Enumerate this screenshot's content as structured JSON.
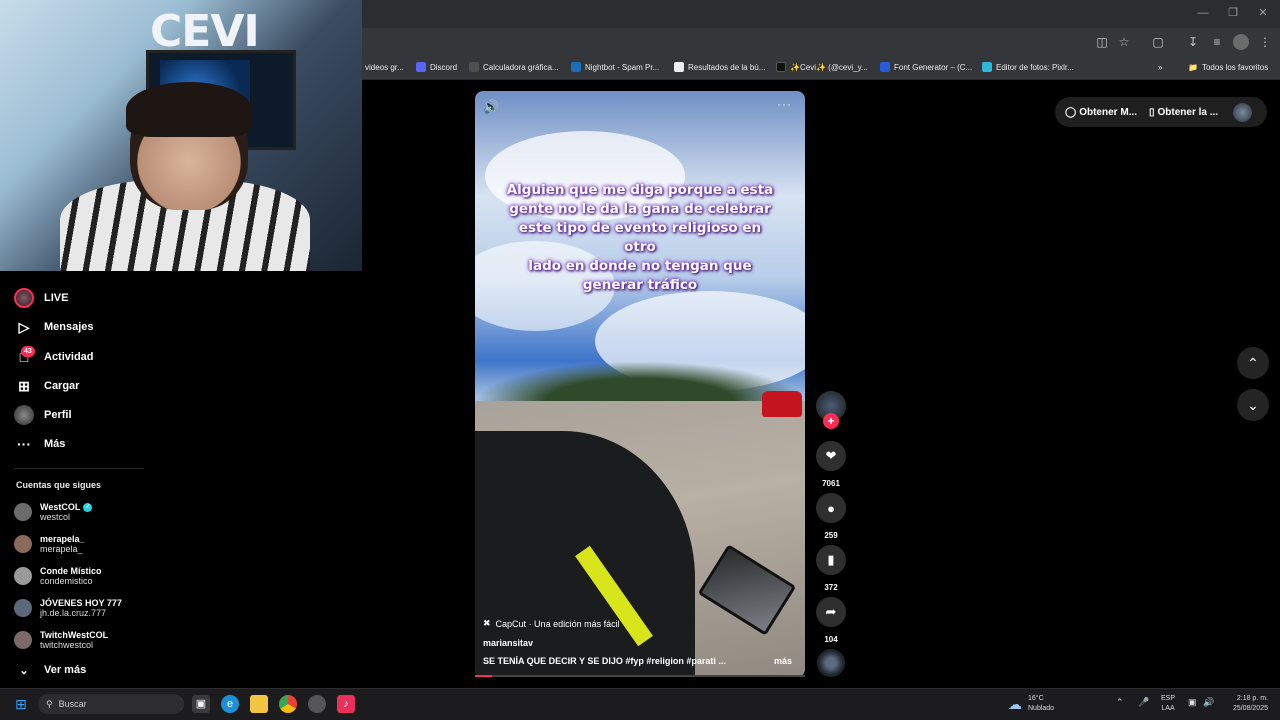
{
  "browser": {
    "bookmarks": [
      {
        "label": "videos gr...",
        "color": "#5f6368"
      },
      {
        "label": "Discord",
        "color": "#5865f2"
      },
      {
        "label": "Calculadora gráfica...",
        "color": "#4f4f4f"
      },
      {
        "label": "Nightbot - Spam Pr...",
        "color": "#1b6fb8"
      },
      {
        "label": "Resultados de la bú...",
        "color": "#eeeeee"
      },
      {
        "label": "✨Cevi✨ (@cevi_y...",
        "color": "#111111"
      },
      {
        "label": "Font Generator – (C...",
        "color": "#2a5bd7"
      },
      {
        "label": "Editor de fotos: Pixlr...",
        "color": "#2fb7d8"
      }
    ],
    "all_bookmarks": "Todos los favoritos"
  },
  "sidebar": {
    "items": [
      {
        "label": "LIVE",
        "icon": "live-icon"
      },
      {
        "label": "Mensajes",
        "icon": "send-icon"
      },
      {
        "label": "Actividad",
        "icon": "activity-icon"
      },
      {
        "label": "Cargar",
        "icon": "upload-icon"
      },
      {
        "label": "Perfil",
        "icon": "profile-icon"
      },
      {
        "label": "Más",
        "icon": "more-icon"
      }
    ],
    "activity_badge": "43",
    "following_title": "Cuentas que sigues",
    "accounts": [
      {
        "name": "WestCOL",
        "handle": "westcol",
        "verified": true,
        "color": "#6b6b6b"
      },
      {
        "name": "merapela_",
        "handle": "merapela_",
        "verified": false,
        "color": "#8a6a5a"
      },
      {
        "name": "Conde Místico",
        "handle": "condemistico",
        "verified": false,
        "color": "#9a9a9a"
      },
      {
        "name": "JÓVENES HOY 777",
        "handle": "jh.de.la.cruz.777",
        "verified": false,
        "color": "#5a6a7a"
      },
      {
        "name": "TwitchWestCOL",
        "handle": "twitchwestcol",
        "verified": false,
        "color": "#7a6a6a"
      }
    ],
    "see_more": "Ver más"
  },
  "webcam": {
    "sign": "CEVI"
  },
  "video": {
    "caption": "Alguien que me diga porque a esta gente no le da la gana de celebrar este tipo de evento religioso en otro lado en donde no tengan que generar tráfico",
    "caption_lines": [
      "Alguien que me diga porque a esta",
      "gente no le da la gana de celebrar",
      "este tipo de evento religioso en otro",
      "lado en donde no tengan que generar tráfico"
    ],
    "capcut": "CapCut · Una edición más fácil",
    "author": "mariansitav",
    "description": "SE TENÍA QUE DECIR Y SE DIJO  #fyp  #religion  #parati  ...",
    "more": "más",
    "progress": 0.05
  },
  "actions": {
    "likes": "7061",
    "comments": "259",
    "saves": "372",
    "shares": "104"
  },
  "top_right": {
    "get_app_1": "Obtener M...",
    "get_app_2": "Obtener la ..."
  },
  "taskbar": {
    "search": "Buscar",
    "weather_temp": "16°C",
    "weather_desc": "Nublado",
    "lang1": "ESP",
    "lang2": "LAA",
    "time": "2:18 p. m.",
    "date": "25/08/2025"
  },
  "colors": {
    "accent": "#fe2c55",
    "verified": "#20d5ec"
  }
}
